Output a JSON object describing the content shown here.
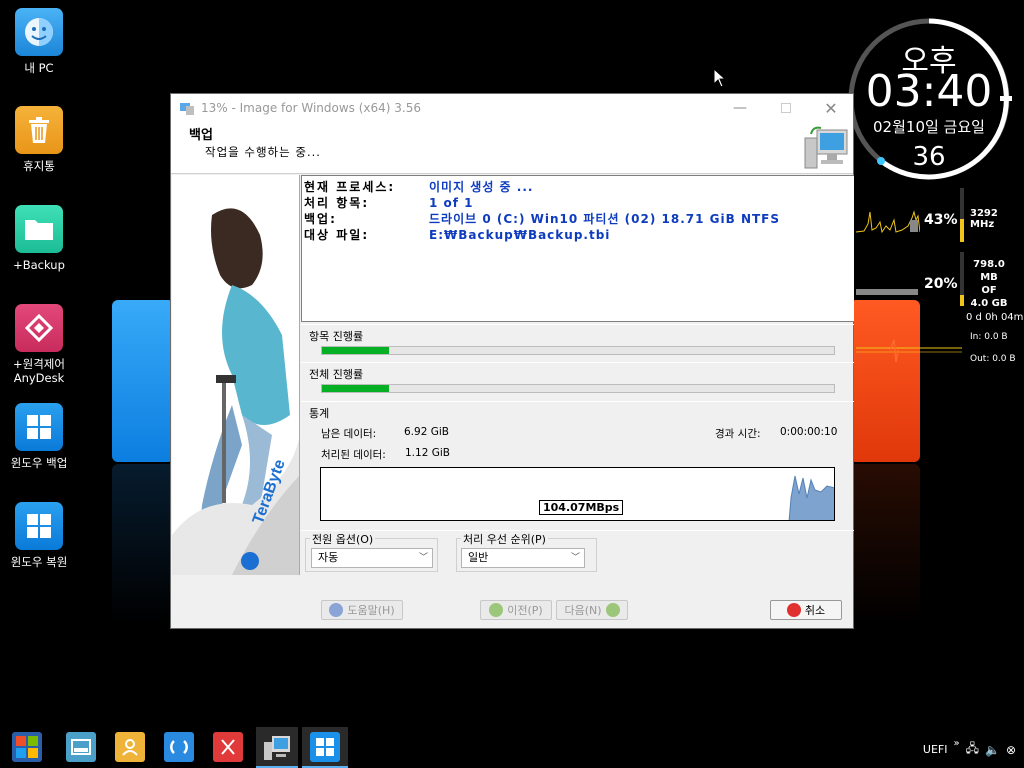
{
  "desktop": {
    "icons": [
      {
        "label": "내 PC"
      },
      {
        "label": "휴지통"
      },
      {
        "label": "+Backup"
      },
      {
        "label": "+원격제어\nAnyDesk"
      },
      {
        "label": "윈도우 백업"
      },
      {
        "label": "윈도우 복원"
      }
    ]
  },
  "clock": {
    "ampm": "오후",
    "time": "03:40",
    "date": "02월10일 금요일",
    "seconds": "36"
  },
  "monitor": {
    "cpu_percent": "43%",
    "cpu_freq": "3292 MHz",
    "cpu_level": 0.43,
    "mem_percent": "20%",
    "mem_used": "798.0 MB",
    "mem_of": "OF",
    "mem_total": "4.0 GB",
    "mem_level": 0.2,
    "uptime": "0 d 0h 04m",
    "net_in": "In: 0.0 B",
    "net_out": "Out: 0.0 B"
  },
  "window": {
    "title": "13% - Image for Windows (x64) 3.56",
    "header_title": "백업",
    "header_subtitle": "작업을 수행하는 중...",
    "info": [
      {
        "label": "현재 프로세스:",
        "value": "이미지 생성 중 ..."
      },
      {
        "label": "처리 항목:",
        "value": "1 of 1"
      },
      {
        "label": "백업:",
        "value": "드라이브 0 (C:) Win10 파티션 (02) 18.71 GiB NTFS"
      },
      {
        "label": "대상 파일:",
        "value": "E:₩Backup₩Backup.tbi"
      }
    ],
    "item_progress_label": "항목 진행률",
    "item_progress": 0.13,
    "total_progress_label": "전체 진행률",
    "total_progress": 0.13,
    "stats_label": "통계",
    "remaining_label": "남은 데이터:",
    "remaining_value": "6.92 GiB",
    "processed_label": "처리된 데이터:",
    "processed_value": "1.12 GiB",
    "elapsed_label": "경과 시간:",
    "elapsed_value": "0:00:00:10",
    "speed": "104.07MBps",
    "power_options_label": "전원 옵션(O)",
    "power_options_value": "자동",
    "priority_label": "처리 우선 순위(P)",
    "priority_value": "일반",
    "help_button": "도움말(H)",
    "prev_button": "이전(P)",
    "next_button": "다음(N)",
    "cancel_button": "취소"
  },
  "taskbar": {
    "tray_text": "UEFI"
  },
  "colors": {
    "accent_blue": "#0e3cbf",
    "progress_green": "#06b025",
    "monitor_yellow": "#f0c419"
  }
}
